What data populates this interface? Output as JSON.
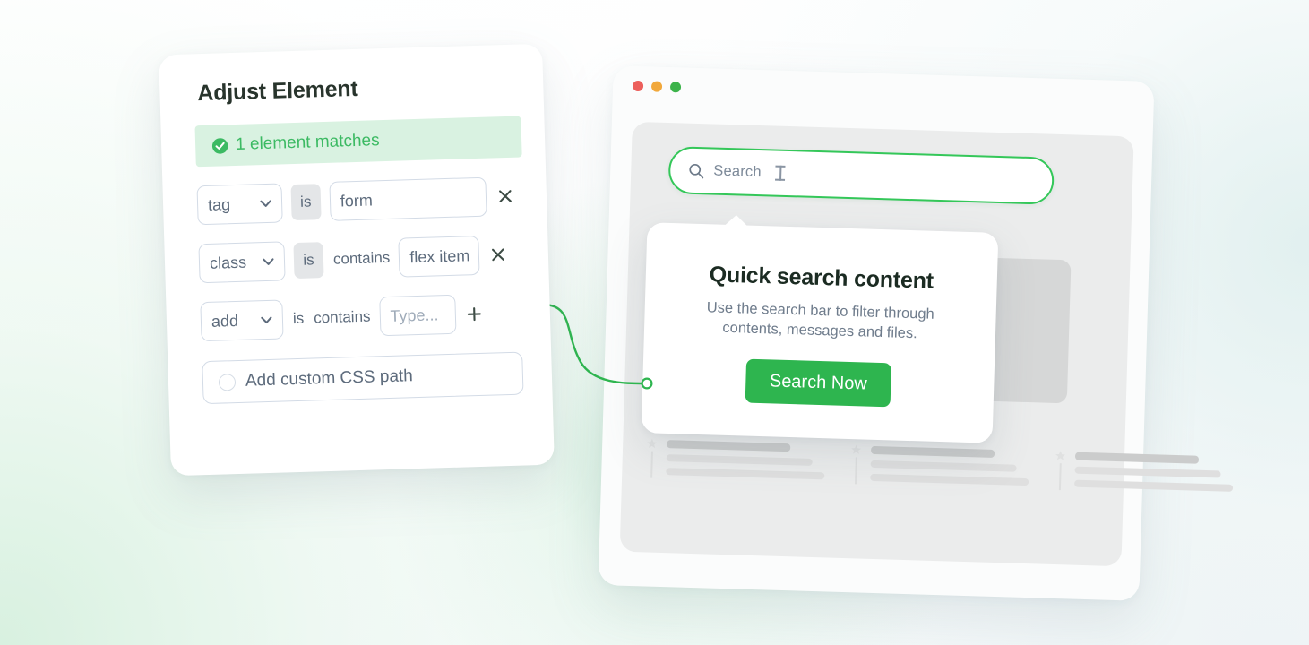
{
  "colors": {
    "accent_green": "#2eb54f",
    "search_border_green": "#34c759",
    "banner_bg": "#d9f2e1",
    "banner_text": "#3cba63",
    "panel_bg": "#ffffff",
    "browser_content_bg": "#ebecec",
    "muted_text": "#5d6b7c",
    "placeholder_text": "#9fabb9",
    "traffic_red": "#ec5f5b",
    "traffic_yellow": "#f1a83b",
    "traffic_green": "#3cb34a"
  },
  "panel": {
    "title": "Adjust Element",
    "match_banner": {
      "icon": "check-circle-icon",
      "text": "1 element matches"
    },
    "rules": [
      {
        "id": "tag",
        "select_value": "tag",
        "select_icon": "chevron-down-icon",
        "operator": "is",
        "operator_style": "pill",
        "secondary_operator": "",
        "input_value": "form",
        "input_placeholder": "",
        "action": "×",
        "action_icon": "close-icon"
      },
      {
        "id": "class",
        "select_value": "class",
        "select_icon": "chevron-down-icon",
        "operator": "is",
        "operator_style": "pill",
        "secondary_operator": "contains",
        "input_value": "flex item",
        "input_placeholder": "",
        "action": "×",
        "action_icon": "close-icon"
      },
      {
        "id": "add",
        "select_value": "add",
        "select_icon": "chevron-down-icon",
        "operator": "is",
        "operator_style": "plain",
        "secondary_operator": "contains",
        "input_value": "",
        "input_placeholder": "Type...",
        "action": "+",
        "action_icon": "plus-icon"
      }
    ],
    "css_path": {
      "radio_label": "Add custom CSS path",
      "selected": false
    }
  },
  "browser": {
    "traffic_lights": [
      "red",
      "yellow",
      "green"
    ],
    "search": {
      "icon": "search-icon",
      "placeholder": "Search",
      "value": "",
      "caret_icon": "text-caret-icon"
    },
    "skeleton_items": [
      {
        "icon": "star-icon"
      },
      {
        "icon": "star-icon"
      },
      {
        "icon": "star-icon"
      }
    ]
  },
  "tooltip": {
    "title": "Quick search content",
    "body": "Use the search bar to filter through contents, messages and files.",
    "button_label": "Search Now"
  }
}
